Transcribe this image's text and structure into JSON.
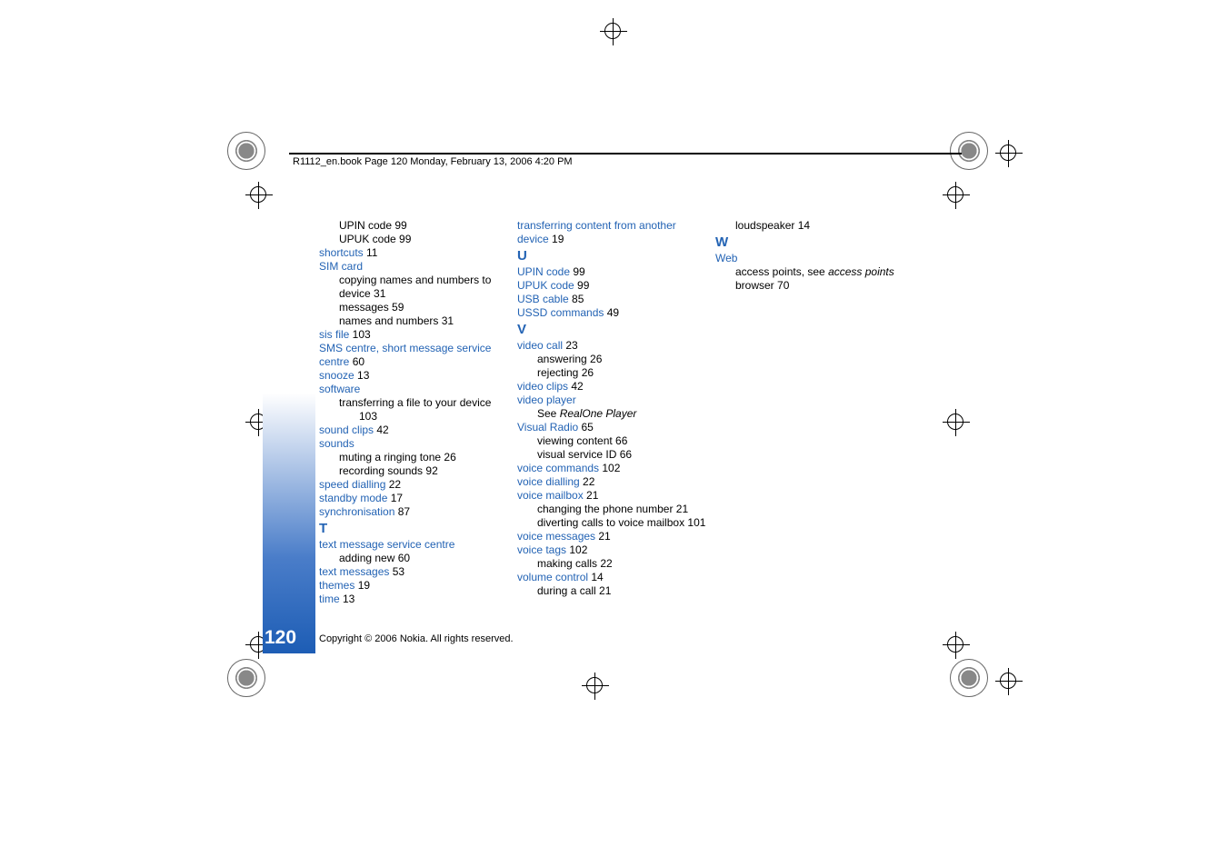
{
  "header": "R1112_en.book  Page 120  Monday, February 13, 2006  4:20 PM",
  "page_number": "120",
  "copyright": "Copyright © 2006 Nokia. All rights reserved.",
  "col1": {
    "upin": "UPIN code",
    "upin_pg": " 99",
    "upuk": "UPUK code",
    "upuk_pg": " 99",
    "shortcuts": "shortcuts",
    "shortcuts_pg": " 11",
    "sim": "SIM card",
    "sim_copy": "copying names and numbers to device",
    "sim_copy_pg": " 31",
    "sim_msg": "messages",
    "sim_msg_pg": " 59",
    "sim_names": "names and numbers",
    "sim_names_pg": " 31",
    "sis": "sis file",
    "sis_pg": " 103",
    "sms": "SMS centre, short message service centre",
    "sms_pg": " 60",
    "snooze": "snooze",
    "snooze_pg": " 13",
    "software": "software",
    "software_transfer": "transferring a file to your device",
    "software_transfer_pg": "103",
    "soundclips": "sound clips",
    "soundclips_pg": " 42",
    "sounds": "sounds",
    "sounds_mute": "muting a ringing tone",
    "sounds_mute_pg": " 26",
    "sounds_rec": "recording sounds",
    "sounds_rec_pg": " 92",
    "speed": "speed dialling",
    "speed_pg": " 22",
    "standby": "standby mode",
    "standby_pg": " 17",
    "sync": "synchronisation",
    "sync_pg": " 87",
    "T": "T",
    "tmsc": "text message service centre",
    "tmsc_add": "adding new",
    "tmsc_add_pg": " 60",
    "tmsg": "text messages",
    "tmsg_pg": " 53",
    "themes": "themes",
    "themes_pg": " 19",
    "time": "time",
    "time_pg": " 13"
  },
  "col2": {
    "transfer": "transferring content from another device",
    "transfer_pg": " 19",
    "U": "U",
    "upin": "UPIN code",
    "upin_pg": " 99",
    "upuk": "UPUK code",
    "upuk_pg": " 99",
    "usb": "USB cable",
    "usb_pg": " 85",
    "ussd": "USSD commands",
    "ussd_pg": " 49",
    "V": "V",
    "vcall": "video call",
    "vcall_pg": " 23",
    "vcall_ans": "answering",
    "vcall_ans_pg": " 26",
    "vcall_rej": "rejecting",
    "vcall_rej_pg": " 26",
    "vclips": "video clips",
    "vclips_pg": " 42",
    "vplayer": "video player",
    "vplayer_see": "See ",
    "vplayer_see_it": "RealOne Player",
    "vradio": "Visual Radio",
    "vradio_pg": " 65",
    "vradio_view": "viewing content",
    "vradio_view_pg": " 66",
    "vradio_id": "visual service ID",
    "vradio_id_pg": " 66",
    "vcmd": "voice commands",
    "vcmd_pg": " 102",
    "vdial": "voice dialling",
    "vdial_pg": " 22",
    "vmail": "voice mailbox",
    "vmail_pg": " 21",
    "vmail_chg": "changing the phone number",
    "vmail_chg_pg": " 21",
    "vmail_div": "diverting calls to voice mailbox",
    "vmail_div_pg": " 101",
    "vmsg": "voice messages",
    "vmsg_pg": " 21",
    "vtags": "voice tags",
    "vtags_pg": " 102",
    "vtags_make": "making calls",
    "vtags_make_pg": " 22",
    "volctl": "volume control",
    "volctl_pg": " 14",
    "volctl_call": "during a call",
    "volctl_call_pg": " 21"
  },
  "col3": {
    "loud": "loudspeaker",
    "loud_pg": " 14",
    "W": "W",
    "web": "Web",
    "web_ap_pre": "access points, see ",
    "web_ap_it": "access points",
    "web_browser": "browser",
    "web_browser_pg": " 70"
  }
}
